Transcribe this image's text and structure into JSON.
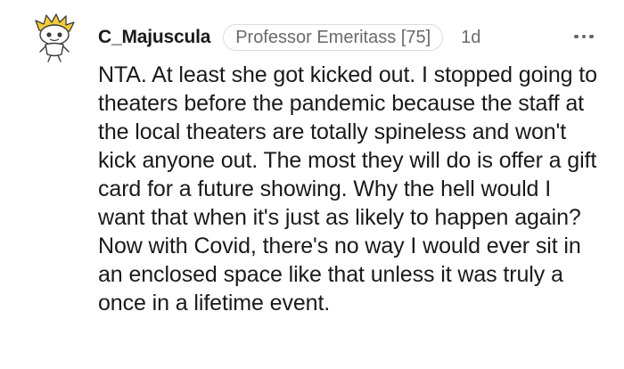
{
  "comment": {
    "author": "C_Majuscula",
    "flair": "Professor Emeritass [75]",
    "age": "1d",
    "more_icon": "more-horizontal-icon",
    "avatar_icon": "snoo-avatar-icon",
    "body": "NTA. At least she got kicked out. I stopped going to theaters before the pandemic because the staff at the local theaters are totally spineless and won't kick anyone out. The most they will do is offer a gift card for a future showing. Why the hell would I want that when it's just as likely to happen again? Now with Covid, there's no way I would ever sit in an enclosed space like that unless it was truly a once in a lifetime event."
  },
  "colors": {
    "text": "#1a1a1b",
    "meta": "#6a6a6a",
    "flair_border": "#dcdcdc",
    "avatar_accent": "#f2cd3a"
  }
}
